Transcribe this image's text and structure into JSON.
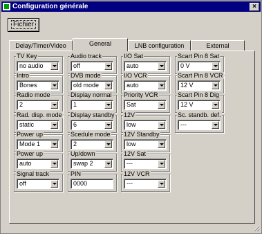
{
  "window": {
    "title": "Configuration générale",
    "close_glyph": "×"
  },
  "toolbar": {
    "fichier_label": "Fichier"
  },
  "tabs": [
    {
      "label": "Delay/Timer/Video",
      "active": false
    },
    {
      "label": "General",
      "active": true
    },
    {
      "label": "LNB configuration",
      "active": false
    },
    {
      "label": "External",
      "active": false
    }
  ],
  "columns": [
    {
      "groups": [
        {
          "label": "TV Key",
          "type": "combo",
          "value": "no audio"
        },
        {
          "label": "Intro",
          "type": "combo",
          "value": "Bones"
        },
        {
          "label": "Radio mode",
          "type": "combo",
          "value": "2"
        },
        {
          "label": "Rad. disp. mode",
          "type": "combo",
          "value": "static"
        },
        {
          "label": "Power up",
          "type": "combo",
          "value": "Mode 1"
        },
        {
          "label": "Power up",
          "type": "combo",
          "value": "auto"
        },
        {
          "label": "Signal track",
          "type": "combo",
          "value": "off"
        }
      ]
    },
    {
      "groups": [
        {
          "label": "Audio track",
          "type": "combo",
          "value": "off"
        },
        {
          "label": "DVB mode",
          "type": "combo",
          "value": "old mode"
        },
        {
          "label": "Display normal",
          "type": "combo",
          "value": "1"
        },
        {
          "label": "Display standby",
          "type": "combo",
          "value": "6"
        },
        {
          "label": "Scedule mode",
          "type": "combo",
          "value": "2"
        },
        {
          "label": "Up/down",
          "type": "combo",
          "value": "swap 2"
        },
        {
          "label": "PIN",
          "type": "text",
          "value": "0000"
        }
      ]
    },
    {
      "groups": [
        {
          "label": "I/O Sat",
          "type": "combo",
          "value": "auto"
        },
        {
          "label": "I/O VCR",
          "type": "combo",
          "value": "auto"
        },
        {
          "label": "Priority VCR",
          "type": "combo",
          "value": "Sat"
        },
        {
          "label": "12V",
          "type": "combo",
          "value": "low"
        },
        {
          "label": "12V Standby",
          "type": "combo",
          "value": "low"
        },
        {
          "label": "12V Sat",
          "type": "combo",
          "value": "---"
        },
        {
          "label": "12V VCR",
          "type": "combo",
          "value": "---"
        }
      ]
    },
    {
      "groups": [
        {
          "label": "Scart Pin 8 Sat",
          "type": "combo",
          "value": "0 V"
        },
        {
          "label": "Scart Pin 8 VCR",
          "type": "combo",
          "value": "12 V"
        },
        {
          "label": "Scart Pin 8 Dig",
          "type": "combo",
          "value": "12 V"
        },
        {
          "label": "Sc. standb. def.",
          "type": "combo",
          "value": "---"
        }
      ]
    }
  ]
}
